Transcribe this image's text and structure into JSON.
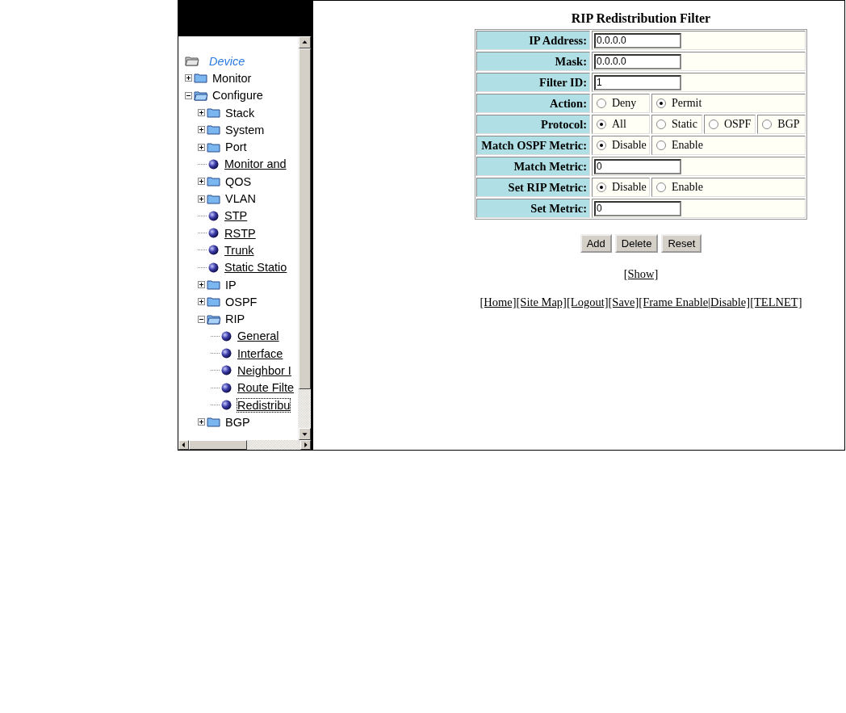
{
  "tree": {
    "label": "Device",
    "children": [
      {
        "kind": "folder",
        "label": "Monitor",
        "expanded": false
      },
      {
        "kind": "folder",
        "label": "Configure",
        "expanded": true,
        "children": [
          {
            "kind": "folder",
            "label": "Stack",
            "expanded": false
          },
          {
            "kind": "folder",
            "label": "System",
            "expanded": false
          },
          {
            "kind": "folder",
            "label": "Port",
            "expanded": false
          },
          {
            "kind": "link",
            "label": "Monitor and",
            "selected": false
          },
          {
            "kind": "folder",
            "label": "QOS",
            "expanded": false
          },
          {
            "kind": "folder",
            "label": "VLAN",
            "expanded": false
          },
          {
            "kind": "link",
            "label": "STP",
            "selected": false
          },
          {
            "kind": "link",
            "label": "RSTP",
            "selected": false
          },
          {
            "kind": "link",
            "label": "Trunk",
            "selected": false
          },
          {
            "kind": "link",
            "label": "Static Statio",
            "selected": false
          },
          {
            "kind": "folder",
            "label": "IP",
            "expanded": false
          },
          {
            "kind": "folder",
            "label": "OSPF",
            "expanded": false
          },
          {
            "kind": "folder",
            "label": "RIP",
            "expanded": true,
            "children": [
              {
                "kind": "link",
                "label": "General",
                "selected": false
              },
              {
                "kind": "link",
                "label": "Interface",
                "selected": false
              },
              {
                "kind": "link",
                "label": "Neighbor I",
                "selected": false
              },
              {
                "kind": "link",
                "label": "Route Filte",
                "selected": false
              },
              {
                "kind": "link",
                "label": "Redistribu",
                "selected": true
              }
            ]
          },
          {
            "kind": "folder",
            "label": "BGP",
            "expanded": false
          }
        ]
      }
    ]
  },
  "form": {
    "title": "RIP Redistribution Filter",
    "rows": [
      {
        "kind": "text",
        "label": "IP Address:",
        "value": "0.0.0.0"
      },
      {
        "kind": "text",
        "label": "Mask:",
        "value": "0.0.0.0"
      },
      {
        "kind": "text",
        "label": "Filter ID:",
        "value": "1"
      },
      {
        "kind": "radio",
        "label": "Action:",
        "options": [
          {
            "label": "Deny",
            "selected": false
          },
          {
            "label": "Permit",
            "selected": true
          }
        ]
      },
      {
        "kind": "radio",
        "label": "Protocol:",
        "options": [
          {
            "label": "All",
            "selected": true
          },
          {
            "label": "Static",
            "selected": false
          },
          {
            "label": "OSPF",
            "selected": false
          },
          {
            "label": "BGP",
            "selected": false
          }
        ]
      },
      {
        "kind": "radio",
        "label": "Match OSPF Metric:",
        "options": [
          {
            "label": "Disable",
            "selected": true
          },
          {
            "label": "Enable",
            "selected": false
          }
        ]
      },
      {
        "kind": "text",
        "label": "Match Metric:",
        "value": "0"
      },
      {
        "kind": "radio",
        "label": "Set RIP Metric:",
        "options": [
          {
            "label": "Disable",
            "selected": true
          },
          {
            "label": "Enable",
            "selected": false
          }
        ]
      },
      {
        "kind": "text",
        "label": "Set Metric:",
        "value": "0"
      }
    ],
    "buttons": [
      "Add",
      "Delete",
      "Reset"
    ],
    "show_link": "[Show]",
    "footer_links": [
      "[Home]",
      "[Site Map]",
      "[Logout]",
      "[Save]",
      "[Frame Enable",
      "|Disable]",
      "[TELNET]"
    ]
  }
}
